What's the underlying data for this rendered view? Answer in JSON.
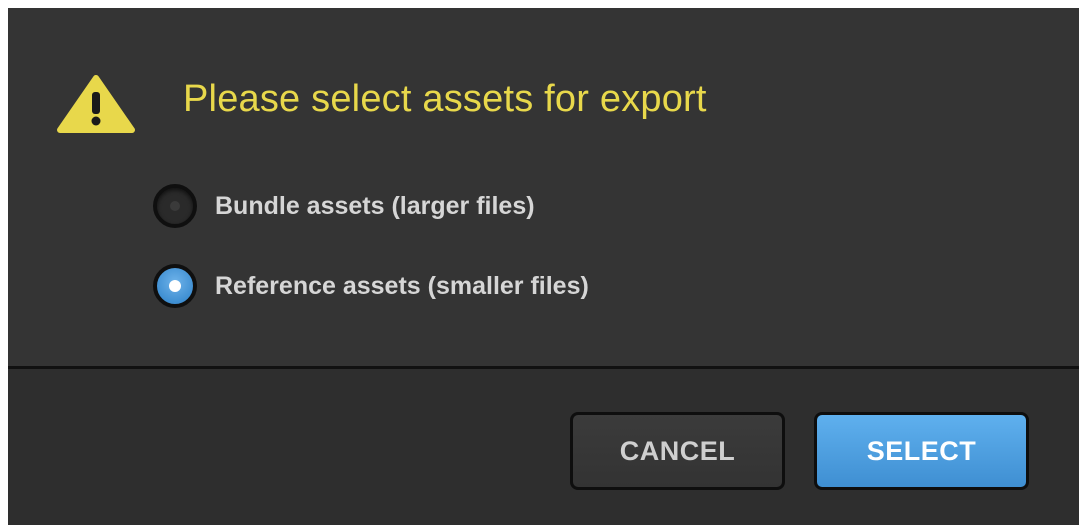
{
  "dialog": {
    "title": "Please select assets for export",
    "icon": "warning-icon",
    "accent_color": "#e8d84b",
    "options": [
      {
        "label": "Bundle assets (larger files)",
        "selected": false
      },
      {
        "label": "Reference assets (smaller files)",
        "selected": true
      }
    ],
    "buttons": {
      "cancel_label": "CANCEL",
      "select_label": "SELECT"
    },
    "primary_color": "#4a9ede"
  }
}
